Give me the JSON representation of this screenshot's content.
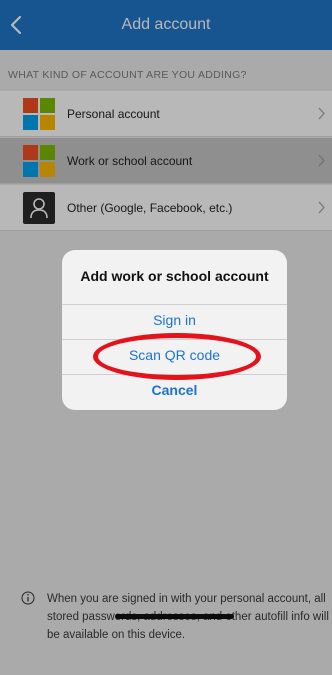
{
  "nav": {
    "title": "Add account",
    "back_icon": "chevron-left-icon"
  },
  "section_header": "WHAT KIND OF ACCOUNT ARE YOU ADDING?",
  "accounts": [
    {
      "label": "Personal account",
      "icon": "microsoft-logo-icon"
    },
    {
      "label": "Work or school account",
      "icon": "microsoft-logo-icon"
    },
    {
      "label": "Other (Google, Facebook, etc.)",
      "icon": "person-icon"
    }
  ],
  "footer": {
    "icon": "info-icon",
    "text": "When you are signed in with your personal account, all stored passwords, addresses, and other autofill info will be available on this device."
  },
  "dialog": {
    "title": "Add work or school account",
    "actions": [
      "Sign in",
      "Scan QR code",
      "Cancel"
    ],
    "highlighted_action": "Scan QR code"
  },
  "colors": {
    "nav_bar": "#1f76c8",
    "action_text": "#1a73d9",
    "highlight_ring": "#e4121a"
  }
}
